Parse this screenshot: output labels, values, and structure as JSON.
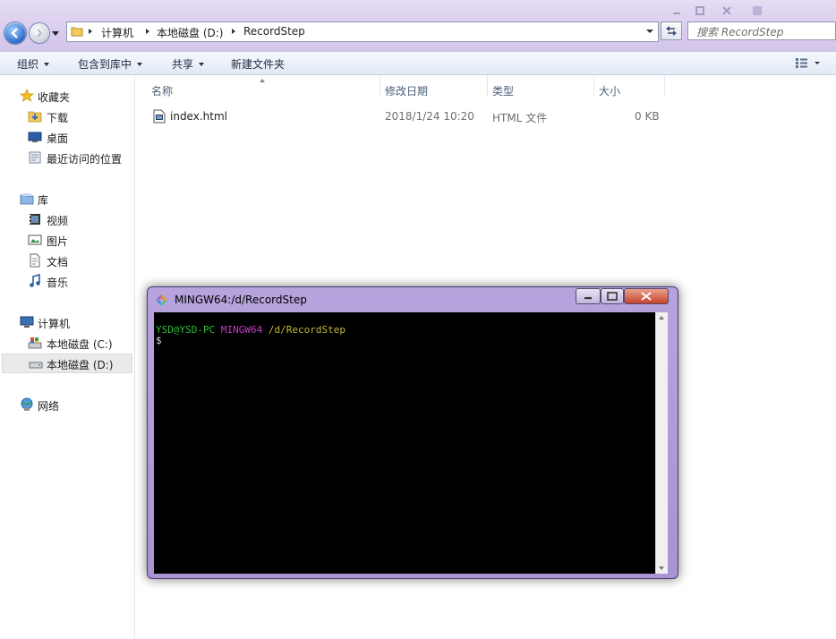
{
  "address": {
    "breadcrumbs": [
      "计算机",
      "本地磁盘 (D:)",
      "RecordStep"
    ],
    "search_placeholder": "搜索 RecordStep"
  },
  "toolbar": {
    "organize": "组织",
    "include_in_library": "包含到库中",
    "share": "共享",
    "new_folder": "新建文件夹"
  },
  "nav": {
    "favorites": {
      "label": "收藏夹",
      "items": [
        "下载",
        "桌面",
        "最近访问的位置"
      ]
    },
    "libraries": {
      "label": "库",
      "items": [
        "视频",
        "图片",
        "文档",
        "音乐"
      ]
    },
    "computer": {
      "label": "计算机",
      "items": [
        "本地磁盘 (C:)",
        "本地磁盘 (D:)"
      ],
      "selected": "本地磁盘 (D:)"
    },
    "network": {
      "label": "网络"
    }
  },
  "columns": {
    "name": "名称",
    "modified": "修改日期",
    "type": "类型",
    "size": "大小"
  },
  "files": [
    {
      "name": "index.html",
      "modified": "2018/1/24 10:20",
      "type": "HTML 文件",
      "size": "0 KB"
    }
  ],
  "terminal": {
    "title": "MINGW64:/d/RecordStep",
    "prompt_user": "YSD@YSD-PC",
    "prompt_env": "MINGW64",
    "prompt_path": "/d/RecordStep",
    "prompt_symbol": "$",
    "colors": {
      "user": "#2fbf3a",
      "env": "#c33bc6",
      "path": "#c2b83a"
    }
  }
}
